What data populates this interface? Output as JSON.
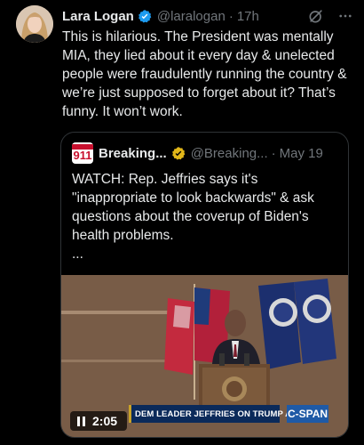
{
  "tweet": {
    "author_name": "Lara Logan",
    "handle": "@laralogan",
    "time": "17h",
    "text": "This is hilarious. The President was mentally MIA, they lied about it every day & unelected people were fraudulently running the country & we’re just supposed to forget about it? That’s funny. It won’t work."
  },
  "quote": {
    "author_name": "Breaking...",
    "handle": "@Breaking...",
    "time": "May 19",
    "avatar_text": "911",
    "text": "WATCH: Rep. Jeffries says it's \"inappropriate to look backwards\" & ask questions about the coverup of Biden's health problems.\n...",
    "video": {
      "duration": "2:05",
      "chyron": "DEM LEADER JEFFRIES ON TRUMP AGENDA",
      "network": "C-SPAN"
    }
  },
  "icons": {
    "verified": "verified-badge-icon",
    "grok": "grok-icon",
    "more": "more-icon",
    "pause": "pause-icon"
  },
  "colors": {
    "background": "#000000",
    "text": "#e7e9ea",
    "muted": "#71767b",
    "verified_blue": "#1d9bf0",
    "verified_gold": "#e2b719",
    "border": "#2f3336"
  }
}
